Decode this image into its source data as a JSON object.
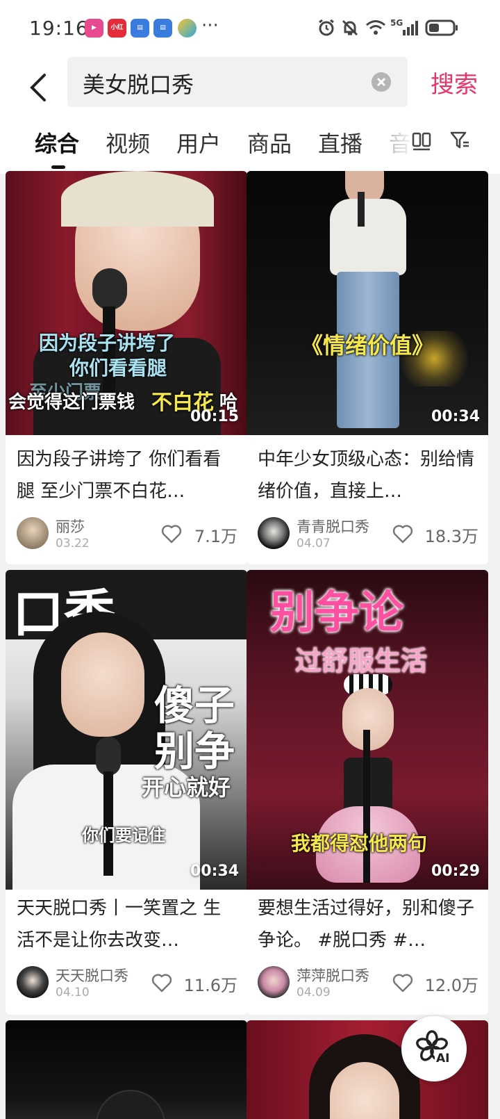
{
  "status_bar": {
    "time": "19:16",
    "app_icons": [
      "video-app-icon",
      "xiaohongshu-icon",
      "notes-icon",
      "notes-icon",
      "multicolor-app-icon"
    ],
    "more": "···",
    "network": "5G"
  },
  "header": {
    "query": "美女脱口秀",
    "search_label": "搜索"
  },
  "tabs": [
    "综合",
    "视频",
    "用户",
    "商品",
    "直播",
    "音"
  ],
  "cards": [
    {
      "title": "因为段子讲垮了 你们看看腿 至少门票不白花…",
      "duration": "00:15",
      "author": "丽莎",
      "date": "03.22",
      "likes": "7.1万",
      "captions": [
        "因为段子讲垮了",
        "你们看看腿",
        "至少门票",
        "会觉得这门票钱",
        "不白花",
        "哈"
      ]
    },
    {
      "title": "中年少女顶级心态：别给情绪价值，直接上…",
      "duration": "00:34",
      "author": "青青脱口秀",
      "date": "04.07",
      "likes": "18.3万",
      "captions": [
        "《情绪价值》"
      ]
    },
    {
      "title": "天天脱口秀丨一笑置之 生活不是让你去改变…",
      "duration": "00:34",
      "author": "天天脱口秀",
      "date": "04.10",
      "likes": "11.6万",
      "captions": [
        "口秀",
        "傻子",
        "别争",
        "开心就好",
        "你们要记住"
      ]
    },
    {
      "title": "要想生活过得好，别和傻子争论。 #脱口秀 #…",
      "duration": "00:29",
      "author": "萍萍脱口秀",
      "date": "04.09",
      "likes": "12.0万",
      "captions": [
        "别争论",
        "过舒服生活",
        "我都得怼他两句"
      ]
    }
  ],
  "ai_button": {
    "label": "AI"
  },
  "colors": {
    "accent": "#e83466",
    "caption_yellow": "#f6e84a"
  }
}
